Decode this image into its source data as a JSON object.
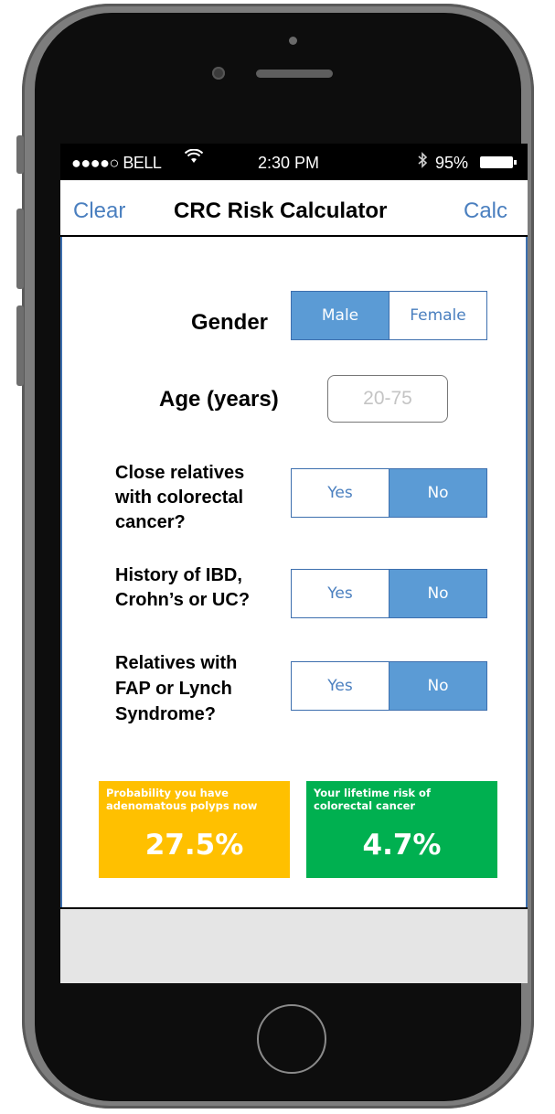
{
  "status_bar": {
    "carrier": "●●●●○ BELL",
    "time": "2:30 PM",
    "battery": "95%",
    "wifi_icon": "wifi-icon",
    "bluetooth_icon": "bluetooth-icon",
    "battery_icon": "battery-icon"
  },
  "nav": {
    "left_button": "Clear",
    "title": "CRC Risk Calculator",
    "right_button": "Calc"
  },
  "form": {
    "gender": {
      "label": "Gender",
      "options": [
        "Male",
        "Female"
      ],
      "selected": "Male"
    },
    "age": {
      "label": "Age (years)",
      "placeholder": "20-75",
      "value": ""
    },
    "relatives_crc": {
      "label_lines": [
        "Close relatives",
        "with colorectal",
        "cancer?"
      ],
      "options": [
        "Yes",
        "No"
      ],
      "selected": "No"
    },
    "ibd_history": {
      "label_lines": [
        "History of IBD,",
        "Crohn’s or UC?"
      ],
      "options": [
        "Yes",
        "No"
      ],
      "selected": "No"
    },
    "fap_lynch": {
      "label_lines": [
        "Relatives with",
        "FAP or Lynch",
        "Syndrome?"
      ],
      "options": [
        "Yes",
        "No"
      ],
      "selected": "No"
    }
  },
  "results": {
    "polyps": {
      "caption_lines": [
        "Probability you have",
        "adenomatous polyps now"
      ],
      "value": "27.5%",
      "color": "#ffc000"
    },
    "lifetime": {
      "caption_lines": [
        "Your lifetime risk of",
        "colorectal cancer"
      ],
      "value": "4.7%",
      "color": "#00b050"
    }
  },
  "colors": {
    "accent": "#5b9bd5",
    "link": "#4a7fbf",
    "border": "#3d6fae"
  }
}
